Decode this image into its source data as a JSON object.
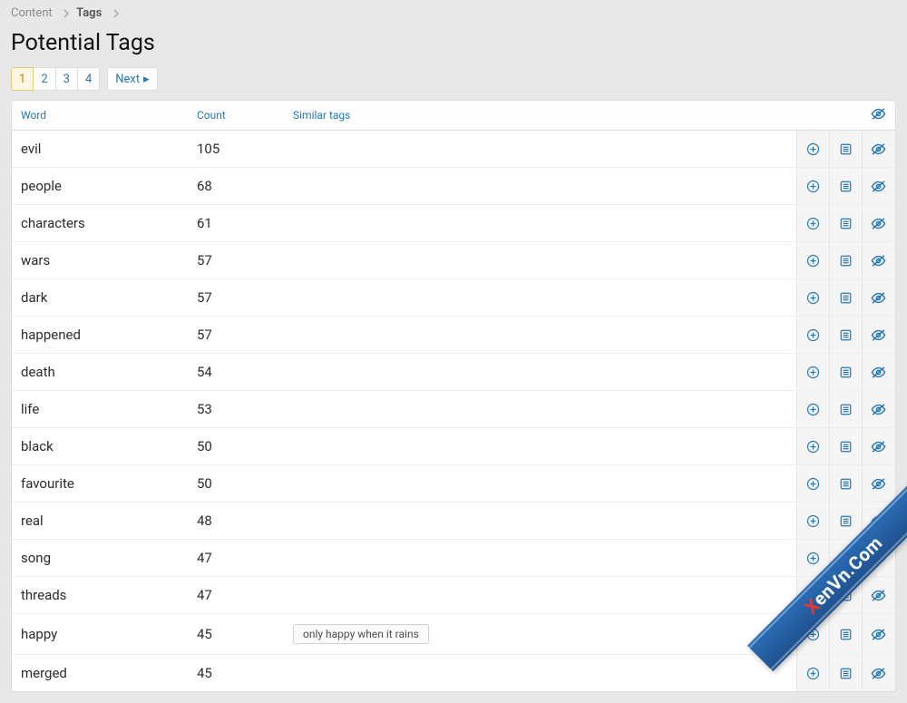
{
  "breadcrumb": {
    "items": [
      {
        "label": "Content",
        "current": false
      },
      {
        "label": "Tags",
        "current": true
      }
    ]
  },
  "page_title": "Potential Tags",
  "pagination": {
    "pages": [
      "1",
      "2",
      "3",
      "4"
    ],
    "active": "1",
    "next_label": "Next"
  },
  "columns": {
    "word": "Word",
    "count": "Count",
    "similar": "Similar tags"
  },
  "rows": [
    {
      "word": "evil",
      "count": "105",
      "similar": []
    },
    {
      "word": "people",
      "count": "68",
      "similar": []
    },
    {
      "word": "characters",
      "count": "61",
      "similar": []
    },
    {
      "word": "wars",
      "count": "57",
      "similar": []
    },
    {
      "word": "dark",
      "count": "57",
      "similar": []
    },
    {
      "word": "happened",
      "count": "57",
      "similar": []
    },
    {
      "word": "death",
      "count": "54",
      "similar": []
    },
    {
      "word": "life",
      "count": "53",
      "similar": []
    },
    {
      "word": "black",
      "count": "50",
      "similar": []
    },
    {
      "word": "favourite",
      "count": "50",
      "similar": []
    },
    {
      "word": "real",
      "count": "48",
      "similar": []
    },
    {
      "word": "song",
      "count": "47",
      "similar": []
    },
    {
      "word": "threads",
      "count": "47",
      "similar": []
    },
    {
      "word": "happy",
      "count": "45",
      "similar": [
        "only happy when it rains"
      ]
    },
    {
      "word": "merged",
      "count": "45",
      "similar": []
    }
  ],
  "icons": {
    "add": "add-circle-icon",
    "list": "list-icon",
    "hide": "eye-off-icon"
  },
  "watermark": {
    "prefix": "X",
    "text": "enVn.Com"
  },
  "colors": {
    "link": "#2577b1",
    "active_bg": "#fff7e6",
    "active_border": "#e6c776"
  }
}
